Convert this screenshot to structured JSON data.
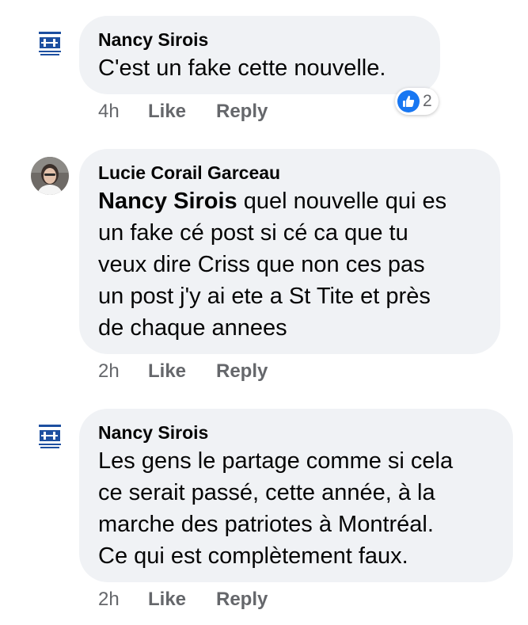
{
  "comments": [
    {
      "author": "Nancy Sirois",
      "text": "C'est un fake cette nouvelle.",
      "time": "4h",
      "like_label": "Like",
      "reply_label": "Reply",
      "reaction": {
        "icon": "thumbs-up-icon",
        "count": "2",
        "color": "#1877f2"
      }
    },
    {
      "author": "Lucie Corail Garceau",
      "mention": "Nancy Sirois",
      "text_lines": [
        " quel nouvelle qui es",
        "un fake cé post si cé ca que tu",
        "veux dire Criss que non ces pas",
        "un post j'y ai ete a St Tite et près",
        "de chaque annees"
      ],
      "time": "2h",
      "like_label": "Like",
      "reply_label": "Reply"
    },
    {
      "author": "Nancy Sirois",
      "text_lines": [
        "Les gens le partage comme si cela",
        "ce serait passé, cette année, à la",
        "marche des patriotes à Montréal.",
        "Ce qui est complètement faux."
      ],
      "time": "2h",
      "like_label": "Like",
      "reply_label": "Reply"
    }
  ]
}
